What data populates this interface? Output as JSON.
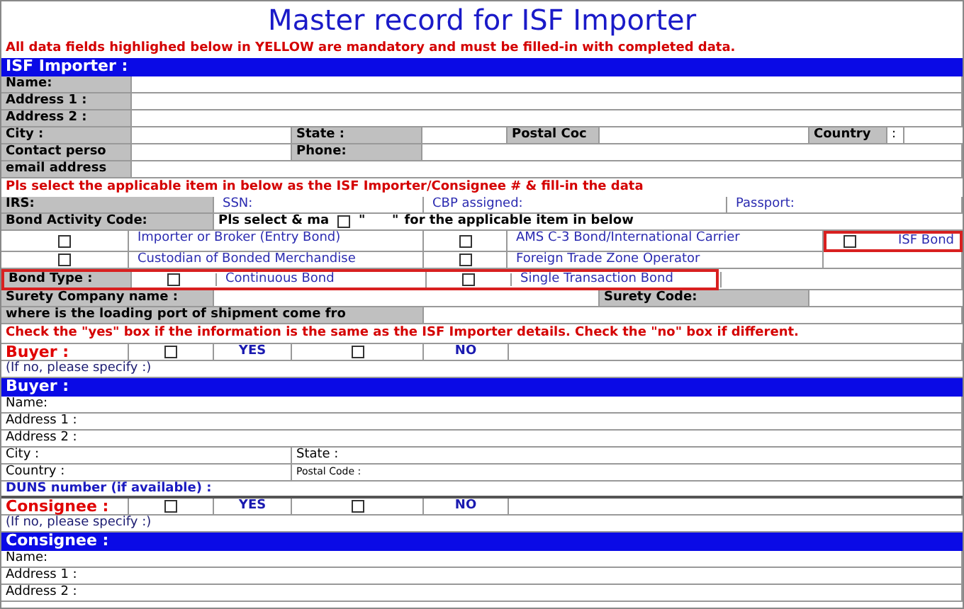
{
  "title": "Master record for ISF Importer",
  "notice": "All data fields highlighed below in YELLOW are mandatory and must be filled-in with completed data.",
  "rows": [
    {
      "kind": "bar",
      "text": "ISF Importer :"
    },
    {
      "kind": "field",
      "cells": [
        {
          "kind": "label",
          "text": "Name:"
        },
        {
          "kind": "field"
        }
      ]
    },
    {
      "kind": "field",
      "cells": [
        {
          "kind": "label",
          "text": "Address 1 :"
        },
        {
          "kind": "field"
        }
      ]
    },
    {
      "kind": "field",
      "cells": [
        {
          "kind": "label",
          "text": "Address 2 :"
        },
        {
          "kind": "field"
        }
      ]
    },
    {
      "kind": "address4",
      "cells": [
        {
          "kind": "label",
          "text": "City :"
        },
        {
          "kind": "field"
        },
        {
          "kind": "label",
          "text": "State :"
        },
        {
          "kind": "field"
        },
        {
          "kind": "label",
          "text": "Postal Coc"
        },
        {
          "kind": "field"
        },
        {
          "kind": "label",
          "text": "Country"
        },
        {
          "kind": "text",
          "text": ":"
        },
        {
          "kind": "field"
        }
      ]
    },
    {
      "kind": "contact",
      "cells": [
        {
          "kind": "label",
          "text": "Contact perso"
        },
        {
          "kind": "field"
        },
        {
          "kind": "label",
          "text": "Phone:"
        },
        {
          "kind": "field"
        }
      ]
    },
    {
      "kind": "field",
      "cells": [
        {
          "kind": "label",
          "text": "email address"
        },
        {
          "kind": "field"
        }
      ]
    },
    {
      "kind": "note",
      "text": "Pls select the applicable item in below as the ISF Importer/Consignee # & fill-in the data"
    },
    {
      "kind": "ids",
      "cells": [
        {
          "kind": "label",
          "text": "IRS:"
        },
        {
          "kind": "option",
          "text": "SSN:"
        },
        {
          "kind": "option",
          "text": "CBP assigned:"
        },
        {
          "kind": "option",
          "text": "Passport:"
        }
      ]
    },
    {
      "kind": "bond-code",
      "cells": [
        {
          "kind": "label",
          "text": "Bond Activity Code:"
        },
        {
          "kind": "inline",
          "parts": [
            {
              "kind": "text",
              "text": "Pls select & ma"
            },
            {
              "kind": "check",
              "checked": false
            },
            {
              "kind": "text",
              "text": "\"      \""
            },
            {
              "kind": "text",
              "text": "for the applicable item in below"
            }
          ]
        }
      ]
    },
    {
      "kind": "options",
      "cells": [
        {
          "kind": "check",
          "checked": false
        },
        {
          "kind": "option",
          "text": "Importer or Broker (Entry Bond)"
        },
        {
          "kind": "check",
          "checked": false
        },
        {
          "kind": "option",
          "text": "AMS C-3 Bond/International Carrier"
        },
        {
          "kind": "check-option",
          "checked": false,
          "text": "ISF Bond",
          "highlighted": true
        }
      ]
    },
    {
      "kind": "options",
      "cells": [
        {
          "kind": "check",
          "checked": false
        },
        {
          "kind": "option",
          "text": "Custodian of Bonded Merchandise"
        },
        {
          "kind": "check",
          "checked": false
        },
        {
          "kind": "option",
          "text": "Foreign Trade Zone Operator"
        },
        {
          "kind": "blank"
        }
      ]
    },
    {
      "kind": "bond-type",
      "highlighted": true,
      "cells": [
        {
          "kind": "label",
          "text": "Bond Type :"
        },
        {
          "kind": "check",
          "checked": false
        },
        {
          "kind": "option",
          "text": "Continuous Bond"
        },
        {
          "kind": "check",
          "checked": false
        },
        {
          "kind": "option",
          "text": "Single Transaction Bond"
        },
        {
          "kind": "blank"
        }
      ]
    },
    {
      "kind": "surety",
      "cells": [
        {
          "kind": "label",
          "text": "Surety Company name :"
        },
        {
          "kind": "field"
        },
        {
          "kind": "label",
          "text": "Surety Code:"
        },
        {
          "kind": "field"
        }
      ]
    },
    {
      "kind": "port",
      "cells": [
        {
          "kind": "label",
          "text": "where is the loading port of shipment come fro"
        },
        {
          "kind": "field"
        }
      ]
    },
    {
      "kind": "para",
      "text": "Check the \"yes\" box if the information is the same as the ISF Importer details.   Check the \"no\" box if different."
    },
    {
      "kind": "yesno",
      "cells": [
        {
          "kind": "red-label",
          "text": "Buyer :"
        },
        {
          "kind": "check",
          "checked": false
        },
        {
          "kind": "choice",
          "text": "YES"
        },
        {
          "kind": "check",
          "checked": false
        },
        {
          "kind": "choice",
          "text": "NO"
        },
        {
          "kind": "blank"
        }
      ]
    },
    {
      "kind": "hint",
      "text": "(If no, please specify :)"
    },
    {
      "kind": "bar",
      "text": "Buyer :"
    },
    {
      "kind": "plain",
      "cells": [
        {
          "kind": "text",
          "text": "Name:"
        }
      ]
    },
    {
      "kind": "plain",
      "cells": [
        {
          "kind": "text",
          "text": "Address 1 :"
        }
      ]
    },
    {
      "kind": "plain",
      "cells": [
        {
          "kind": "text",
          "text": "Address 2 :"
        }
      ]
    },
    {
      "kind": "plain-two",
      "cells": [
        {
          "kind": "text",
          "text": "City :"
        },
        {
          "kind": "text",
          "text": "State :"
        }
      ]
    },
    {
      "kind": "plain-two",
      "cells": [
        {
          "kind": "text",
          "text": "Country :"
        },
        {
          "kind": "small",
          "text": "Postal Code :"
        }
      ]
    },
    {
      "kind": "duns",
      "text": "DUNS number (if available) :"
    },
    {
      "kind": "yesno",
      "cells": [
        {
          "kind": "red-label",
          "text": "Consignee :"
        },
        {
          "kind": "check",
          "checked": false
        },
        {
          "kind": "choice",
          "text": "YES"
        },
        {
          "kind": "check",
          "checked": false
        },
        {
          "kind": "choice",
          "text": "NO"
        },
        {
          "kind": "blank"
        }
      ]
    },
    {
      "kind": "hint",
      "text": "(If no, please specify :)"
    },
    {
      "kind": "bar",
      "text": "Consignee :"
    },
    {
      "kind": "plain",
      "cells": [
        {
          "kind": "text",
          "text": "Name:"
        }
      ]
    },
    {
      "kind": "plain",
      "cells": [
        {
          "kind": "text",
          "text": "Address 1 :"
        }
      ]
    },
    {
      "kind": "plain",
      "cells": [
        {
          "kind": "text",
          "text": "Address 2 :"
        }
      ]
    }
  ]
}
